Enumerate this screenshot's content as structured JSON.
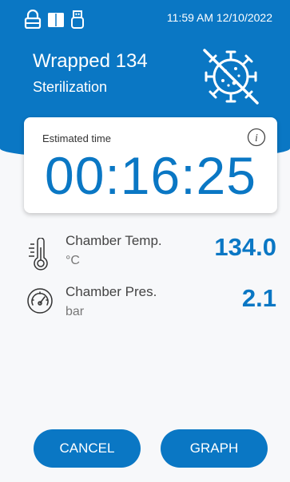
{
  "status_bar": {
    "icons": [
      "lock-icon",
      "book-icon",
      "usb-icon"
    ],
    "datetime": "11:59 AM 12/10/2022"
  },
  "program": {
    "title": "Wrapped 134",
    "subtitle": "Sterilization",
    "icon": "virus-crossed-icon"
  },
  "timer": {
    "label": "Estimated time",
    "value": "00:16:25",
    "info_icon": "info-icon"
  },
  "readings": [
    {
      "label": "Chamber Temp.",
      "unit": "°C",
      "value": "134.0",
      "icon": "thermometer-icon"
    },
    {
      "label": "Chamber Pres.",
      "unit": "bar",
      "value": "2.1",
      "icon": "gauge-icon"
    }
  ],
  "buttons": {
    "cancel": "CANCEL",
    "graph": "GRAPH"
  },
  "colors": {
    "accent": "#0a77c4",
    "background": "#f7f8fa"
  }
}
